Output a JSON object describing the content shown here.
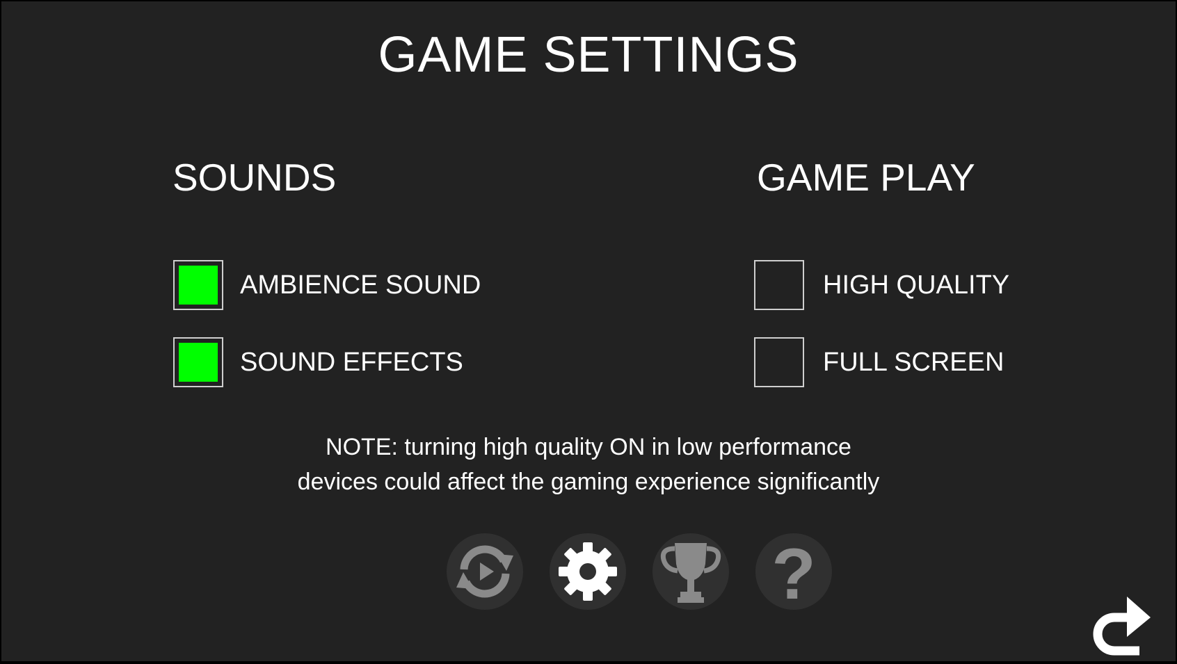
{
  "title": "GAME SETTINGS",
  "sounds": {
    "heading": "SOUNDS",
    "options": [
      {
        "label": "AMBIENCE SOUND",
        "checked": true
      },
      {
        "label": "SOUND EFFECTS",
        "checked": true
      }
    ]
  },
  "gameplay": {
    "heading": "GAME PLAY",
    "options": [
      {
        "label": "HIGH QUALITY",
        "checked": false
      },
      {
        "label": "FULL SCREEN",
        "checked": false
      }
    ]
  },
  "note": {
    "line1": "NOTE: turning high quality ON in low performance",
    "line2": "devices could affect the gaming experience significantly"
  },
  "bottom_icons": [
    {
      "name": "replay-icon"
    },
    {
      "name": "gear-icon"
    },
    {
      "name": "trophy-icon"
    },
    {
      "name": "help-icon"
    }
  ],
  "back_icon": "back-arrow-icon",
  "colors": {
    "background": "#222222",
    "text": "#ffffff",
    "checked": "#00ff00",
    "icon_circle": "#303030",
    "icon_dim": "#8a8a8a",
    "icon_active": "#ffffff"
  }
}
